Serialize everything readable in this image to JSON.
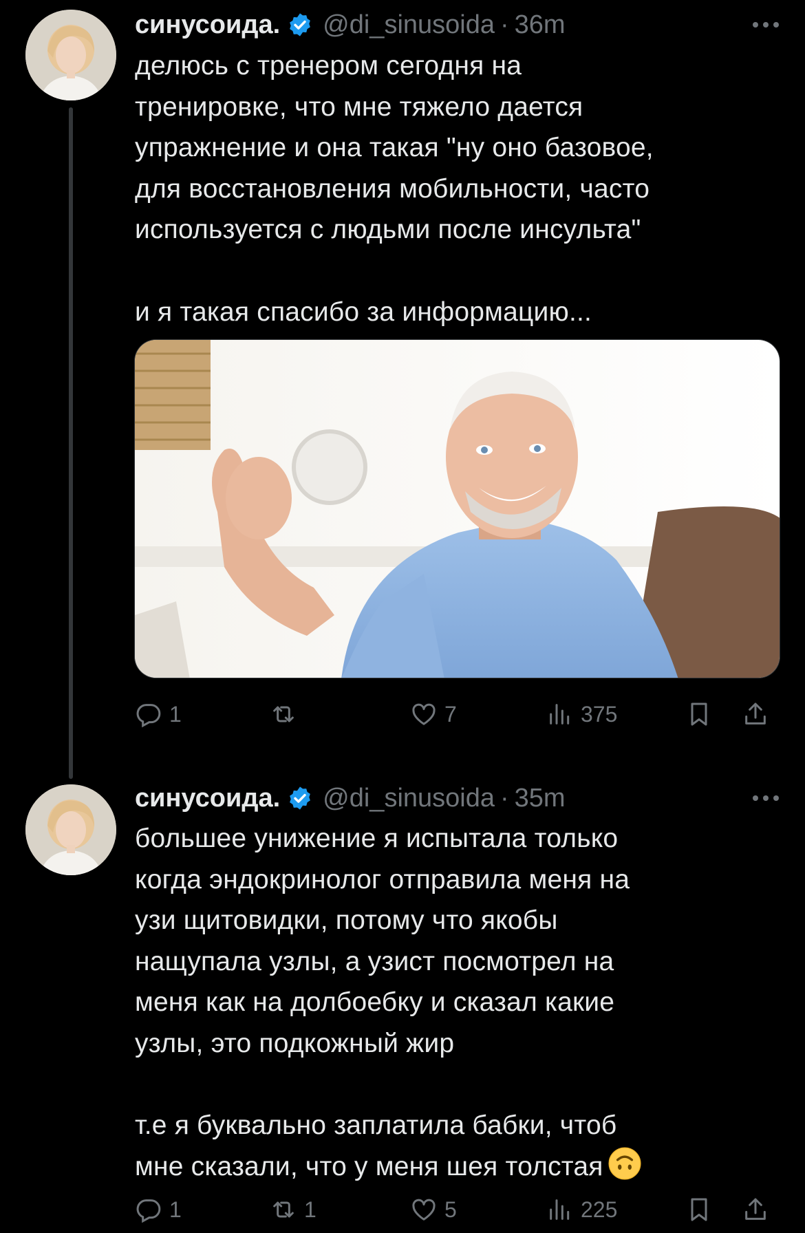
{
  "tweets": [
    {
      "display_name": "синусоида.",
      "handle": "@di_sinusoida",
      "separator": "·",
      "time": "36m",
      "text": "делюсь с тренером сегодня на\nтренировке, что мне тяжело дается\nупражнение и она такая \"ну оно базовое,\nдля восстановления мобильности, часто\nиспользуется с людьми после инсульта\"\n\nи я такая спасибо за информацию...",
      "has_media": true,
      "counts": {
        "replies": "1",
        "retweets": "",
        "likes": "7",
        "views": "375"
      }
    },
    {
      "display_name": "синусоида.",
      "handle": "@di_sinusoida",
      "separator": "·",
      "time": "35m",
      "text": "большее унижение я испытала только\nкогда эндокринолог отправила меня на\nузи щитовидки, потому что якобы\nнащупала узлы, а узист посмотрел на\nменя как на долбоебку и сказал какие\nузлы, это подкожный жир\n\nт.е я буквально заплатила бабки, чтоб\nмне сказали, что у меня шея толстая",
      "text_end_emoji": "upside-down-face",
      "has_media": false,
      "counts": {
        "replies": "1",
        "retweets": "1",
        "likes": "5",
        "views": "225"
      }
    }
  ],
  "colors": {
    "background": "#000000",
    "text": "#e7e9ea",
    "secondary": "#71767b",
    "verified": "#1d9bf0",
    "thread_line": "#333639"
  },
  "icons": [
    "verified-badge-icon",
    "more-icon",
    "reply-icon",
    "retweet-icon",
    "like-icon",
    "views-icon",
    "bookmark-icon",
    "share-icon"
  ]
}
